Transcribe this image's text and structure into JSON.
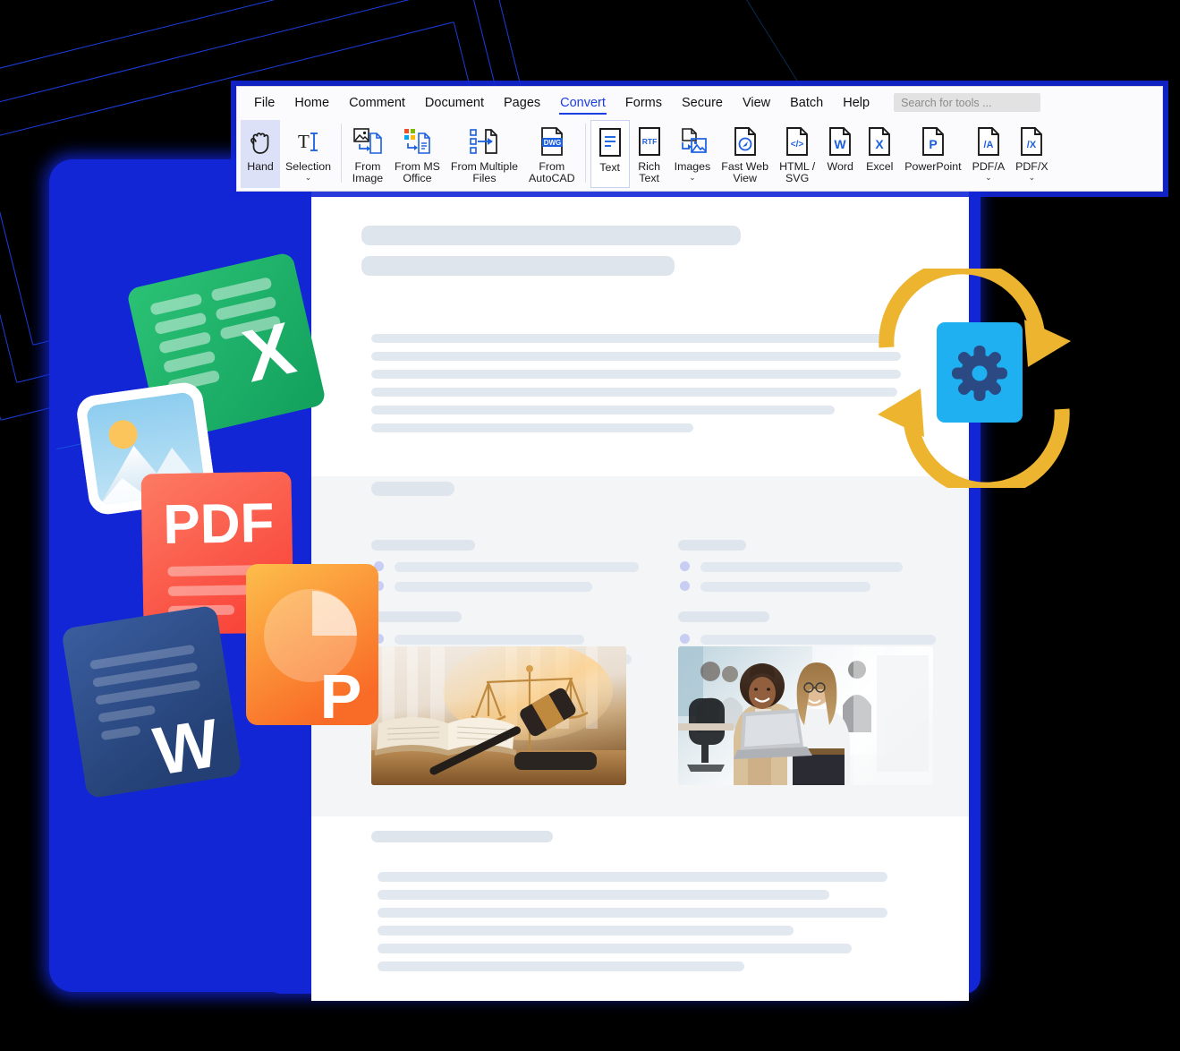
{
  "app": {
    "name": "PDF Editor Ribbon",
    "accent": "#1a3fe0",
    "panel_blue": "#1226d6"
  },
  "menubar": {
    "items": [
      {
        "label": "File",
        "active": false
      },
      {
        "label": "Home",
        "active": false
      },
      {
        "label": "Comment",
        "active": false
      },
      {
        "label": "Document",
        "active": false
      },
      {
        "label": "Pages",
        "active": false
      },
      {
        "label": "Convert",
        "active": true
      },
      {
        "label": "Forms",
        "active": false
      },
      {
        "label": "Secure",
        "active": false
      },
      {
        "label": "View",
        "active": false
      },
      {
        "label": "Batch",
        "active": false
      },
      {
        "label": "Help",
        "active": false
      }
    ],
    "search": {
      "placeholder": "Search for tools ...",
      "value": ""
    }
  },
  "toolbar": {
    "tools": [
      {
        "id": "hand",
        "label": "Hand",
        "icon": "hand-icon",
        "caret": false,
        "state": "selected"
      },
      {
        "id": "selection",
        "label": "Selection",
        "icon": "text-selection-icon",
        "caret": true,
        "state": "normal"
      },
      {
        "id": "from-image",
        "label": "From\nImage",
        "icon": "from-image-icon",
        "caret": true,
        "state": "normal",
        "inline_caret": true
      },
      {
        "id": "from-ms-office",
        "label": "From MS\nOffice",
        "icon": "from-ms-office-icon",
        "caret": false,
        "state": "normal"
      },
      {
        "id": "from-multiple",
        "label": "From Multiple\nFiles",
        "icon": "from-multiple-files-icon",
        "caret": false,
        "state": "normal"
      },
      {
        "id": "from-autocad",
        "label": "From\nAutoCAD",
        "icon": "dwg-file-icon",
        "caret": false,
        "state": "normal"
      },
      {
        "id": "text",
        "label": "Text",
        "icon": "text-file-icon",
        "caret": false,
        "state": "outlined"
      },
      {
        "id": "rich-text",
        "label": "Rich\nText",
        "icon": "rtf-file-icon",
        "caret": false,
        "state": "normal"
      },
      {
        "id": "images",
        "label": "Images",
        "icon": "to-images-icon",
        "caret": true,
        "state": "normal"
      },
      {
        "id": "fast-web-view",
        "label": "Fast Web\nView",
        "icon": "fast-web-view-icon",
        "caret": false,
        "state": "normal"
      },
      {
        "id": "html-svg",
        "label": "HTML /\nSVG",
        "icon": "html-svg-file-icon",
        "caret": false,
        "state": "normal"
      },
      {
        "id": "word",
        "label": "Word",
        "icon": "word-file-icon",
        "caret": false,
        "state": "normal"
      },
      {
        "id": "excel",
        "label": "Excel",
        "icon": "excel-file-icon",
        "caret": false,
        "state": "normal"
      },
      {
        "id": "powerpoint",
        "label": "PowerPoint",
        "icon": "powerpoint-file-icon",
        "caret": false,
        "state": "normal"
      },
      {
        "id": "pdf-a",
        "label": "PDF/A",
        "icon": "pdfa-file-icon",
        "caret": true,
        "state": "normal"
      },
      {
        "id": "pdf-x",
        "label": "PDF/X",
        "icon": "pdfx-file-icon",
        "caret": true,
        "state": "normal"
      }
    ],
    "icon_glyphs": {
      "dwg": "DWG",
      "rtf": "RTF",
      "html": "</>",
      "word": "W",
      "excel": "X",
      "powerpoint": "P",
      "pdfa": "/A",
      "pdfx": "/X"
    }
  },
  "document_preview": {
    "description": "Skeleton placeholder document page with two photos",
    "photos": [
      {
        "id": "photo-gavel",
        "alt": "gavel-and-law-book"
      },
      {
        "id": "photo-office",
        "alt": "two-women-with-laptop-in-office"
      }
    ]
  },
  "file_icons": [
    {
      "id": "excel-doc-icon",
      "letter": "X",
      "color": "#1fa463"
    },
    {
      "id": "image-doc-icon",
      "letter": "",
      "color": "#8ecdf0"
    },
    {
      "id": "pdf-doc-icon",
      "letter": "PDF",
      "color": "#f9584a"
    },
    {
      "id": "powerpoint-doc-icon",
      "letter": "P",
      "color": "#f98026"
    },
    {
      "id": "word-doc-icon",
      "letter": "W",
      "color": "#2b4a84"
    }
  ],
  "conversion_badge": {
    "id": "conversion-cycle-badge",
    "arrow_color": "#edb430",
    "card_color": "#1eb0f0",
    "gear_color": "#2b4a84",
    "icon": "gear-icon"
  }
}
